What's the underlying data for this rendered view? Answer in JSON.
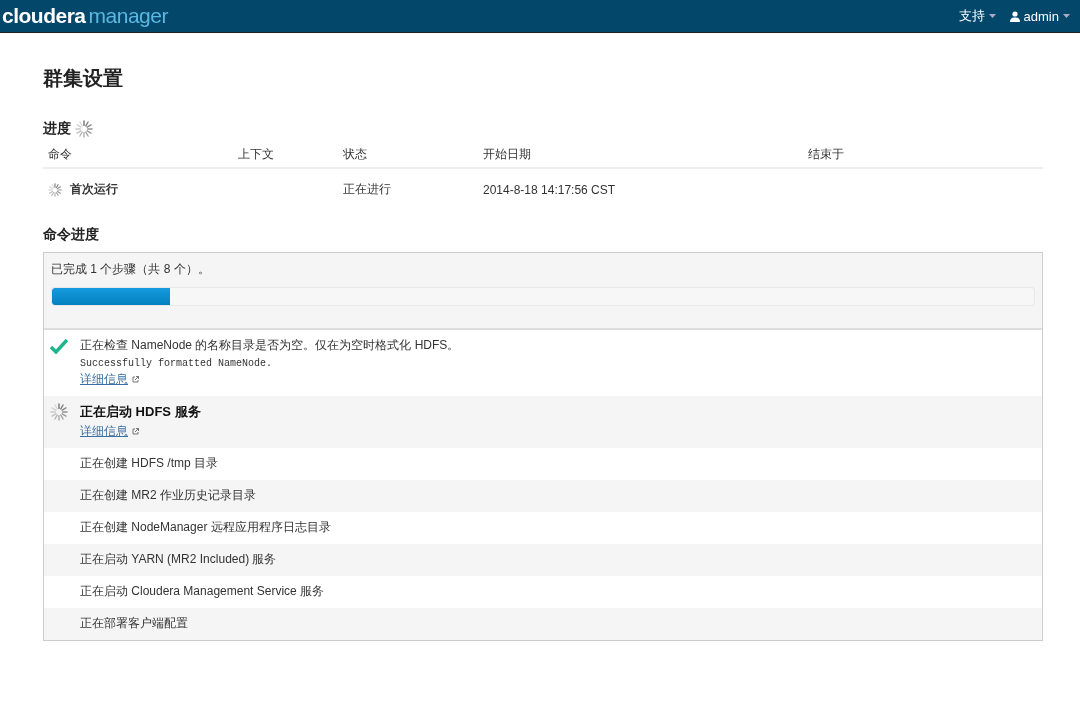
{
  "header": {
    "logo_primary": "cloudera",
    "logo_secondary": "manager",
    "menus": [
      {
        "label": "支持",
        "kind": "plain"
      },
      {
        "label": "admin",
        "kind": "user"
      }
    ]
  },
  "page_title": "群集设置",
  "progress": {
    "title": "进度",
    "running": true,
    "table": {
      "columns": [
        "命令",
        "上下文",
        "状态",
        "开始日期",
        "结束于"
      ],
      "rows": [
        {
          "running": true,
          "cells": [
            "首次运行",
            "",
            "正在进行",
            "2014-8-18 14:17:56 CST",
            ""
          ]
        }
      ]
    }
  },
  "command_progress": {
    "title": "命令进度",
    "summary": "已完成 1 个步骤（共 8 个）。",
    "level": 0.12,
    "steps": [
      {
        "kind": "done",
        "title": "正在检查 NameNode 的名称目录是否为空。仅在为空时格式化 HDFS。",
        "output": "Successfully formatted NameNode.",
        "link": "详细信息"
      },
      {
        "kind": "running",
        "title": "正在启动 HDFS 服务",
        "link": "详细信息"
      },
      {
        "kind": "pending",
        "title": "正在创建 HDFS /tmp 目录"
      },
      {
        "kind": "pending",
        "title": "正在创建 MR2 作业历史记录目录"
      },
      {
        "kind": "pending",
        "title": "正在创建 NodeManager 远程应用程序日志目录"
      },
      {
        "kind": "pending",
        "title": "正在启动 YARN (MR2 Included) 服务"
      },
      {
        "kind": "pending",
        "title": "正在启动 Cloudera Management Service 服务"
      },
      {
        "kind": "pending",
        "title": "正在部署客户端配置"
      }
    ]
  }
}
